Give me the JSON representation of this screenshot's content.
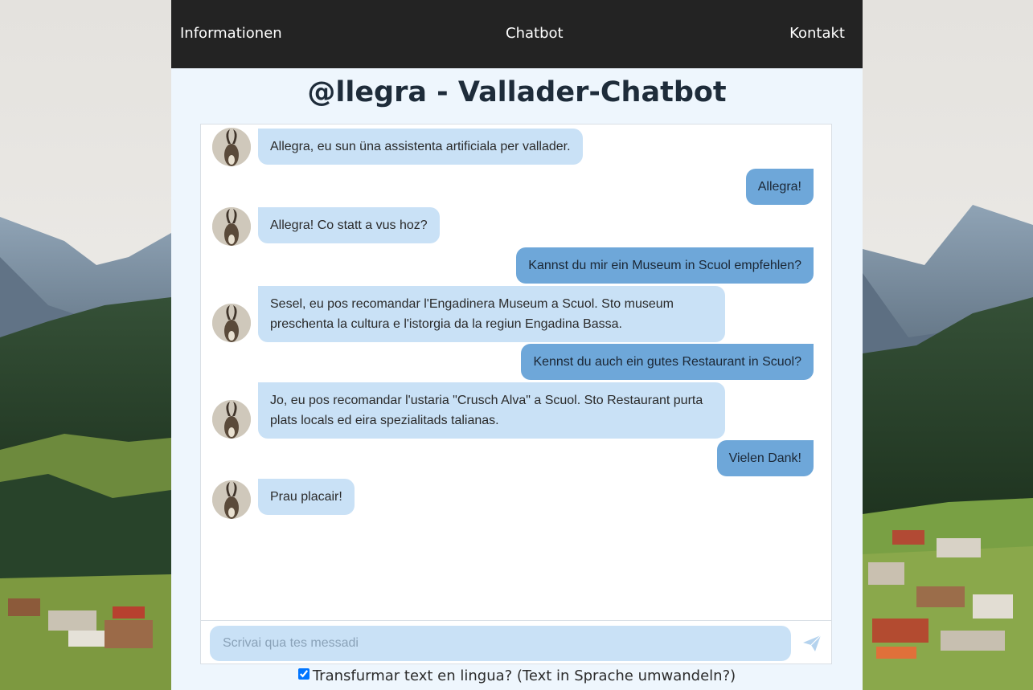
{
  "nav": {
    "items": [
      {
        "label": "Informationen"
      },
      {
        "label": "Chatbot"
      },
      {
        "label": "Kontakt"
      }
    ]
  },
  "page": {
    "title": "@llegra - Vallader-Chatbot"
  },
  "colors": {
    "bot_bubble": "#c9e1f6",
    "user_bubble": "#6ea7d9",
    "nav_bg": "#232323"
  },
  "messages": [
    {
      "from": "bot",
      "text": "Allegra, eu sun üna assistenta artificiala per vallader."
    },
    {
      "from": "user",
      "text": "Allegra!"
    },
    {
      "from": "bot",
      "text": "Allegra! Co statt a vus hoz?"
    },
    {
      "from": "user",
      "text": "Kannst du mir ein Museum in Scuol empfehlen?"
    },
    {
      "from": "bot",
      "text": "Sesel, eu pos recomandar l'Engadinera Museum a Scuol. Sto museum preschenta la cultura e l'istorgia da la regiun Engadina Bassa."
    },
    {
      "from": "user",
      "text": "Kennst du auch ein gutes Restaurant in Scuol?"
    },
    {
      "from": "bot",
      "text": "Jo, eu pos recomandar l'ustaria \"Crusch Alva\" a Scuol. Sto Restaurant purta plats locals ed eira spezialitads talianas."
    },
    {
      "from": "user",
      "text": "Vielen Dank!"
    },
    {
      "from": "bot",
      "text": "Prau placair!"
    }
  ],
  "input": {
    "placeholder": "Scrivai qua tes messadi",
    "value": "",
    "send_icon": "send-icon"
  },
  "tts": {
    "label": "Transfurmar text en lingua? (Text in Sprache umwandeln?)",
    "checked": true
  }
}
